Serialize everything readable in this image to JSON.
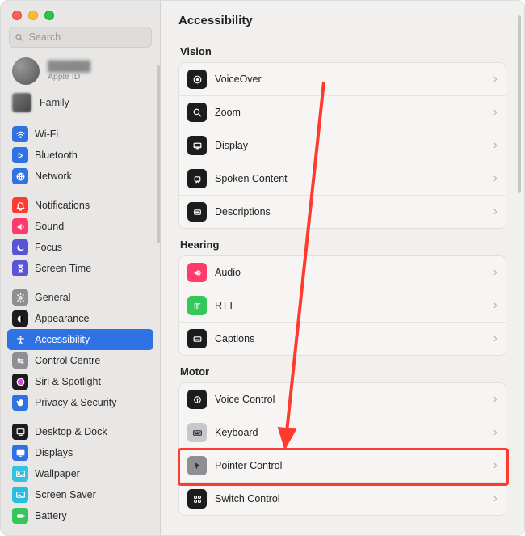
{
  "header": {
    "title": "Accessibility"
  },
  "search": {
    "placeholder": "Search"
  },
  "profile": {
    "name": "██████",
    "subtitle": "Apple ID"
  },
  "family": {
    "label": "Family"
  },
  "sidebar": {
    "groups": [
      [
        {
          "label": "Wi-Fi",
          "icon": "wifi",
          "bg": "#2f72e4"
        },
        {
          "label": "Bluetooth",
          "icon": "bt",
          "bg": "#2f72e4"
        },
        {
          "label": "Network",
          "icon": "net",
          "bg": "#2f72e4"
        }
      ],
      [
        {
          "label": "Notifications",
          "icon": "bell",
          "bg": "#ff3b30"
        },
        {
          "label": "Sound",
          "icon": "sound",
          "bg": "#ff3b6b"
        },
        {
          "label": "Focus",
          "icon": "moon",
          "bg": "#5856d6"
        },
        {
          "label": "Screen Time",
          "icon": "hourglass",
          "bg": "#5856d6"
        }
      ],
      [
        {
          "label": "General",
          "icon": "gear",
          "bg": "#8e8e93"
        },
        {
          "label": "Appearance",
          "icon": "appear",
          "bg": "#1c1c1e"
        },
        {
          "label": "Accessibility",
          "icon": "access",
          "bg": "#2f72e4",
          "selected": true
        },
        {
          "label": "Control Centre",
          "icon": "cc",
          "bg": "#8e8e93"
        },
        {
          "label": "Siri & Spotlight",
          "icon": "siri",
          "bg": "#1c1c1e"
        },
        {
          "label": "Privacy & Security",
          "icon": "hand",
          "bg": "#2f72e4"
        }
      ],
      [
        {
          "label": "Desktop & Dock",
          "icon": "dock",
          "bg": "#1c1c1e"
        },
        {
          "label": "Displays",
          "icon": "disp",
          "bg": "#2f72e4"
        },
        {
          "label": "Wallpaper",
          "icon": "wall",
          "bg": "#34c2e0"
        },
        {
          "label": "Screen Saver",
          "icon": "ss",
          "bg": "#25bfe2"
        },
        {
          "label": "Battery",
          "icon": "batt",
          "bg": "#34c759"
        }
      ]
    ]
  },
  "sections": [
    {
      "title": "Vision",
      "items": [
        {
          "label": "VoiceOver",
          "icon": "vo",
          "bg": "#1c1c1e"
        },
        {
          "label": "Zoom",
          "icon": "zoom",
          "bg": "#1c1c1e"
        },
        {
          "label": "Display",
          "icon": "disp2",
          "bg": "#1c1c1e"
        },
        {
          "label": "Spoken Content",
          "icon": "spoken",
          "bg": "#1c1c1e"
        },
        {
          "label": "Descriptions",
          "icon": "desc",
          "bg": "#1c1c1e"
        }
      ]
    },
    {
      "title": "Hearing",
      "items": [
        {
          "label": "Audio",
          "icon": "audio",
          "bg": "#ff3b6b"
        },
        {
          "label": "RTT",
          "icon": "rtt",
          "bg": "#34c759"
        },
        {
          "label": "Captions",
          "icon": "cap",
          "bg": "#1c1c1e"
        }
      ]
    },
    {
      "title": "Motor",
      "items": [
        {
          "label": "Voice Control",
          "icon": "vc",
          "bg": "#1c1c1e"
        },
        {
          "label": "Keyboard",
          "icon": "kb",
          "bg": "#c7c7cc"
        },
        {
          "label": "Pointer Control",
          "icon": "ptr",
          "bg": "#8e8e93",
          "highlight": true
        },
        {
          "label": "Switch Control",
          "icon": "sw",
          "bg": "#1c1c1e"
        }
      ]
    }
  ],
  "annotation": {
    "arrow_color": "#ff3b2f"
  }
}
